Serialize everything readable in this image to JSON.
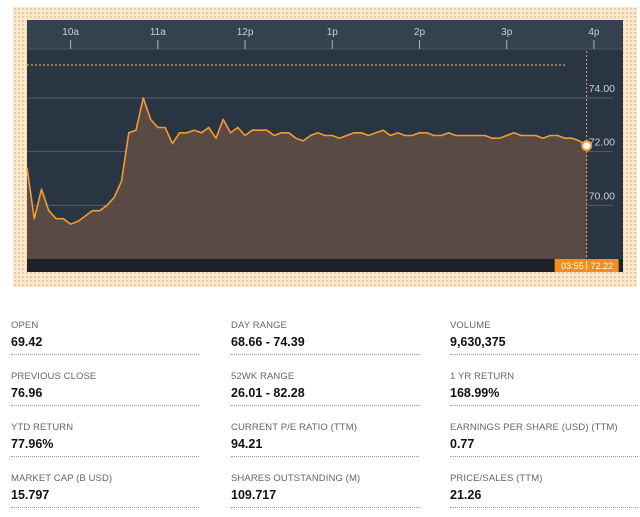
{
  "chart_data": {
    "type": "area",
    "x_ticks": [
      "10a",
      "11a",
      "12p",
      "1p",
      "2p",
      "3p",
      "4p"
    ],
    "y_ticks": [
      70.0,
      72.0,
      74.0
    ],
    "y_tick_labels": [
      "70.00",
      "72.00",
      "74.00"
    ],
    "ylim": [
      68.0,
      75.6
    ],
    "xlim": [
      "09:30",
      "16:20"
    ],
    "previous_close": 76.96,
    "grid": true,
    "series": [
      {
        "x": [
          "09:30",
          "09:35",
          "09:40",
          "09:45",
          "09:50",
          "09:55",
          "10:00",
          "10:05",
          "10:10",
          "10:15",
          "10:20",
          "10:25",
          "10:30",
          "10:35",
          "10:40",
          "10:45",
          "10:50",
          "10:55",
          "11:00",
          "11:05",
          "11:10",
          "11:15",
          "11:20",
          "11:25",
          "11:30",
          "11:35",
          "11:40",
          "11:45",
          "11:50",
          "11:55",
          "12:00",
          "12:05",
          "12:10",
          "12:15",
          "12:20",
          "12:25",
          "12:30",
          "12:35",
          "12:40",
          "12:45",
          "12:50",
          "12:55",
          "13:00",
          "13:05",
          "13:10",
          "13:15",
          "13:20",
          "13:25",
          "13:30",
          "13:35",
          "13:40",
          "13:45",
          "13:50",
          "13:55",
          "14:00",
          "14:05",
          "14:10",
          "14:15",
          "14:20",
          "14:25",
          "14:30",
          "14:35",
          "14:40",
          "14:45",
          "14:50",
          "14:55",
          "15:00",
          "15:05",
          "15:10",
          "15:15",
          "15:20",
          "15:25",
          "15:30",
          "15:35",
          "15:40",
          "15:45",
          "15:50",
          "15:55"
        ],
        "values": [
          71.4,
          69.5,
          70.6,
          69.8,
          69.5,
          69.5,
          69.3,
          69.4,
          69.6,
          69.8,
          69.8,
          70.0,
          70.3,
          70.9,
          72.7,
          72.8,
          74.0,
          73.2,
          72.9,
          72.9,
          72.3,
          72.7,
          72.7,
          72.8,
          72.7,
          72.9,
          72.5,
          73.2,
          72.7,
          72.9,
          72.6,
          72.8,
          72.8,
          72.8,
          72.6,
          72.7,
          72.7,
          72.5,
          72.4,
          72.6,
          72.7,
          72.6,
          72.6,
          72.5,
          72.6,
          72.7,
          72.7,
          72.6,
          72.7,
          72.8,
          72.6,
          72.7,
          72.6,
          72.6,
          72.7,
          72.7,
          72.6,
          72.6,
          72.7,
          72.6,
          72.6,
          72.6,
          72.6,
          72.6,
          72.5,
          72.5,
          72.6,
          72.7,
          72.6,
          72.6,
          72.6,
          72.5,
          72.6,
          72.6,
          72.5,
          72.5,
          72.4,
          72.22
        ]
      }
    ],
    "last_point": {
      "time": "03:55",
      "value": "72.22"
    },
    "colors": {
      "background": "#293542",
      "header": "#34414f",
      "axis_bar": "#1e2228",
      "line": "#f39a36",
      "fill": "#5c4d45",
      "grid": "#56606b",
      "marker_label_bg": "#f28e1c",
      "frame": "#fbe9cf"
    }
  },
  "stats": [
    {
      "label": "OPEN",
      "value": "69.42"
    },
    {
      "label": "DAY RANGE",
      "value": "68.66 - 74.39"
    },
    {
      "label": "VOLUME",
      "value": "9,630,375"
    },
    {
      "label": "PREVIOUS CLOSE",
      "value": "76.96"
    },
    {
      "label": "52WK RANGE",
      "value": "26.01 - 82.28"
    },
    {
      "label": "1 YR RETURN",
      "value": "168.99%"
    },
    {
      "label": "YTD RETURN",
      "value": "77.96%"
    },
    {
      "label": "CURRENT P/E RATIO (TTM)",
      "value": "94.21"
    },
    {
      "label": "EARNINGS PER SHARE (USD) (TTM)",
      "value": "0.77"
    },
    {
      "label": "MARKET CAP (B USD)",
      "value": "15.797"
    },
    {
      "label": "SHARES OUTSTANDING (M)",
      "value": "109.717"
    },
    {
      "label": "PRICE/SALES (TTM)",
      "value": "21.26"
    }
  ]
}
